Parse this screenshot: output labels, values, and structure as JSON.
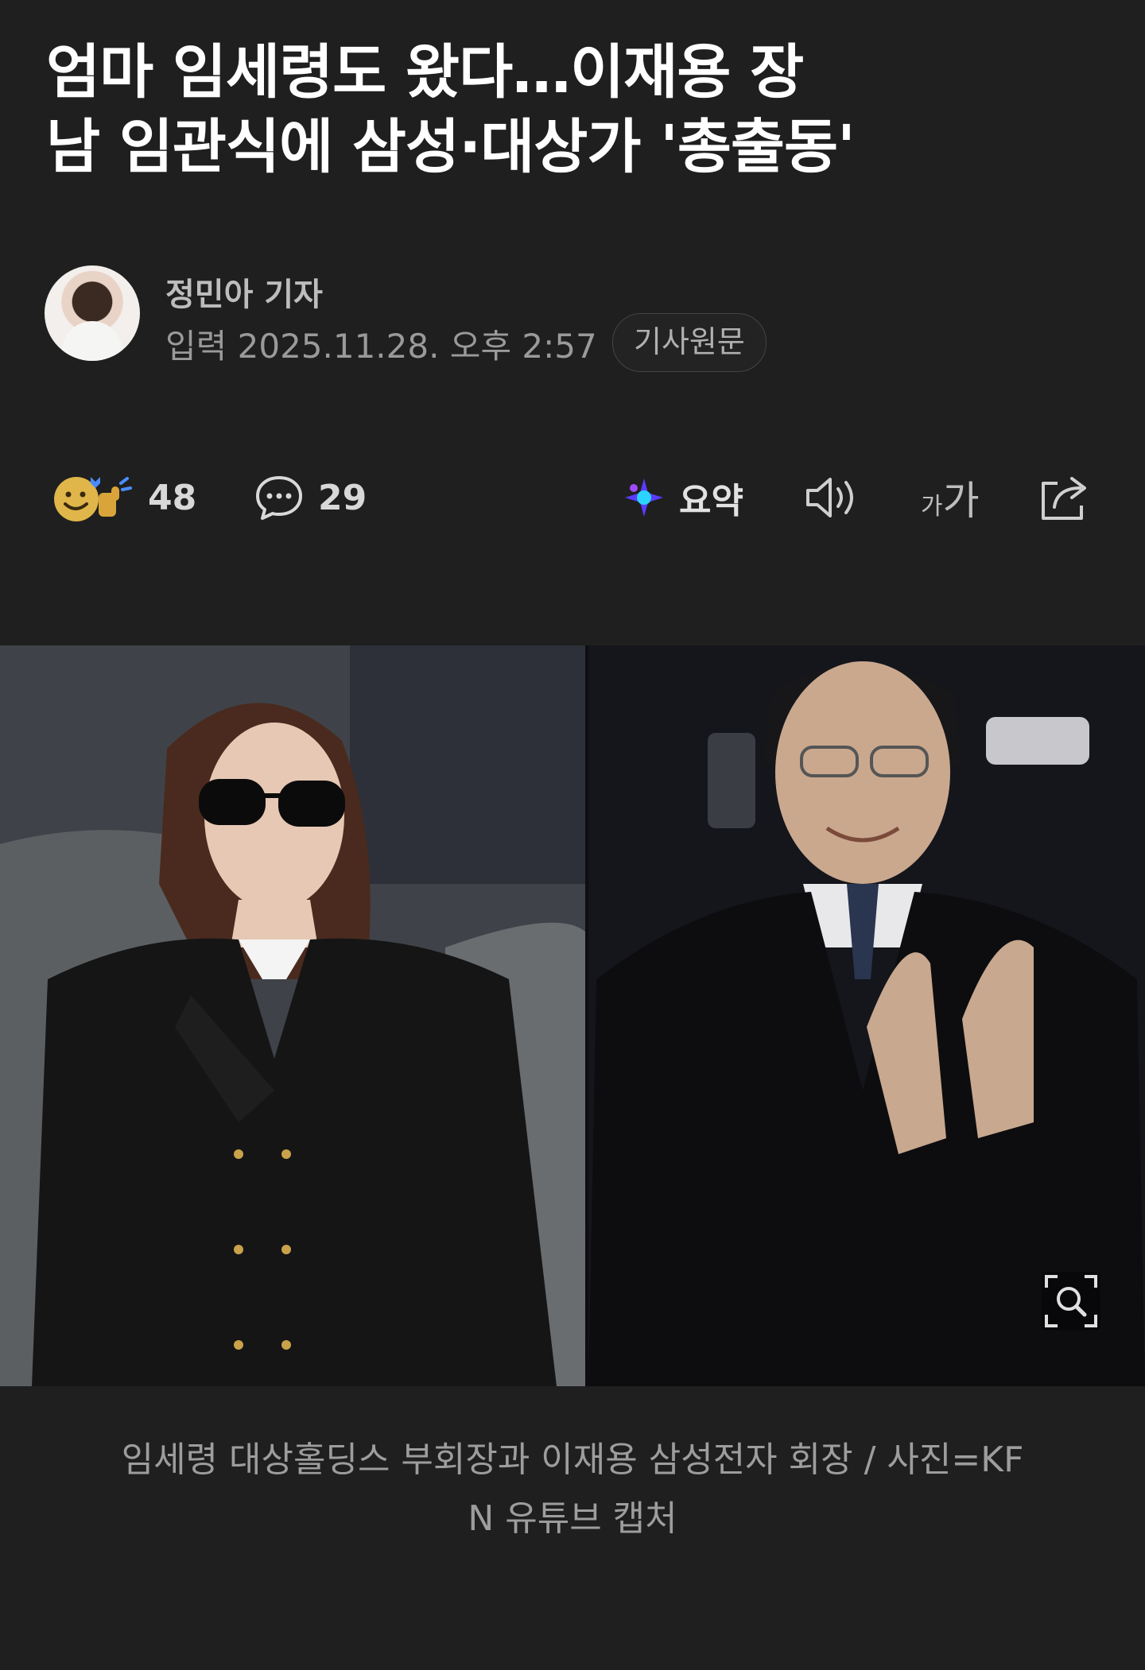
{
  "article": {
    "headline_line1": "엄마 임세령도 왔다…이재용 장",
    "headline_line2": "남 임관식에 삼성·대상가 '총출동'",
    "author": "정민아 기자",
    "date": "입력 2025.11.28. 오후 2:57",
    "original_button": "기사원문"
  },
  "toolbar": {
    "reaction_count": "48",
    "comment_count": "29",
    "summary_label": "요약",
    "font_size_label_small": "가",
    "font_size_label_large": "가"
  },
  "photo": {
    "caption_line1": "임세령 대상홀딩스 부회장과 이재용 삼성전자 회장 / 사진=KF",
    "caption_line2": "N 유튜브 캡처"
  },
  "colors": {
    "background": "#1f1f1f",
    "headline": "#ffffff",
    "muted_text": "#9a9a9a",
    "accent_summary": "#6a3cff"
  }
}
